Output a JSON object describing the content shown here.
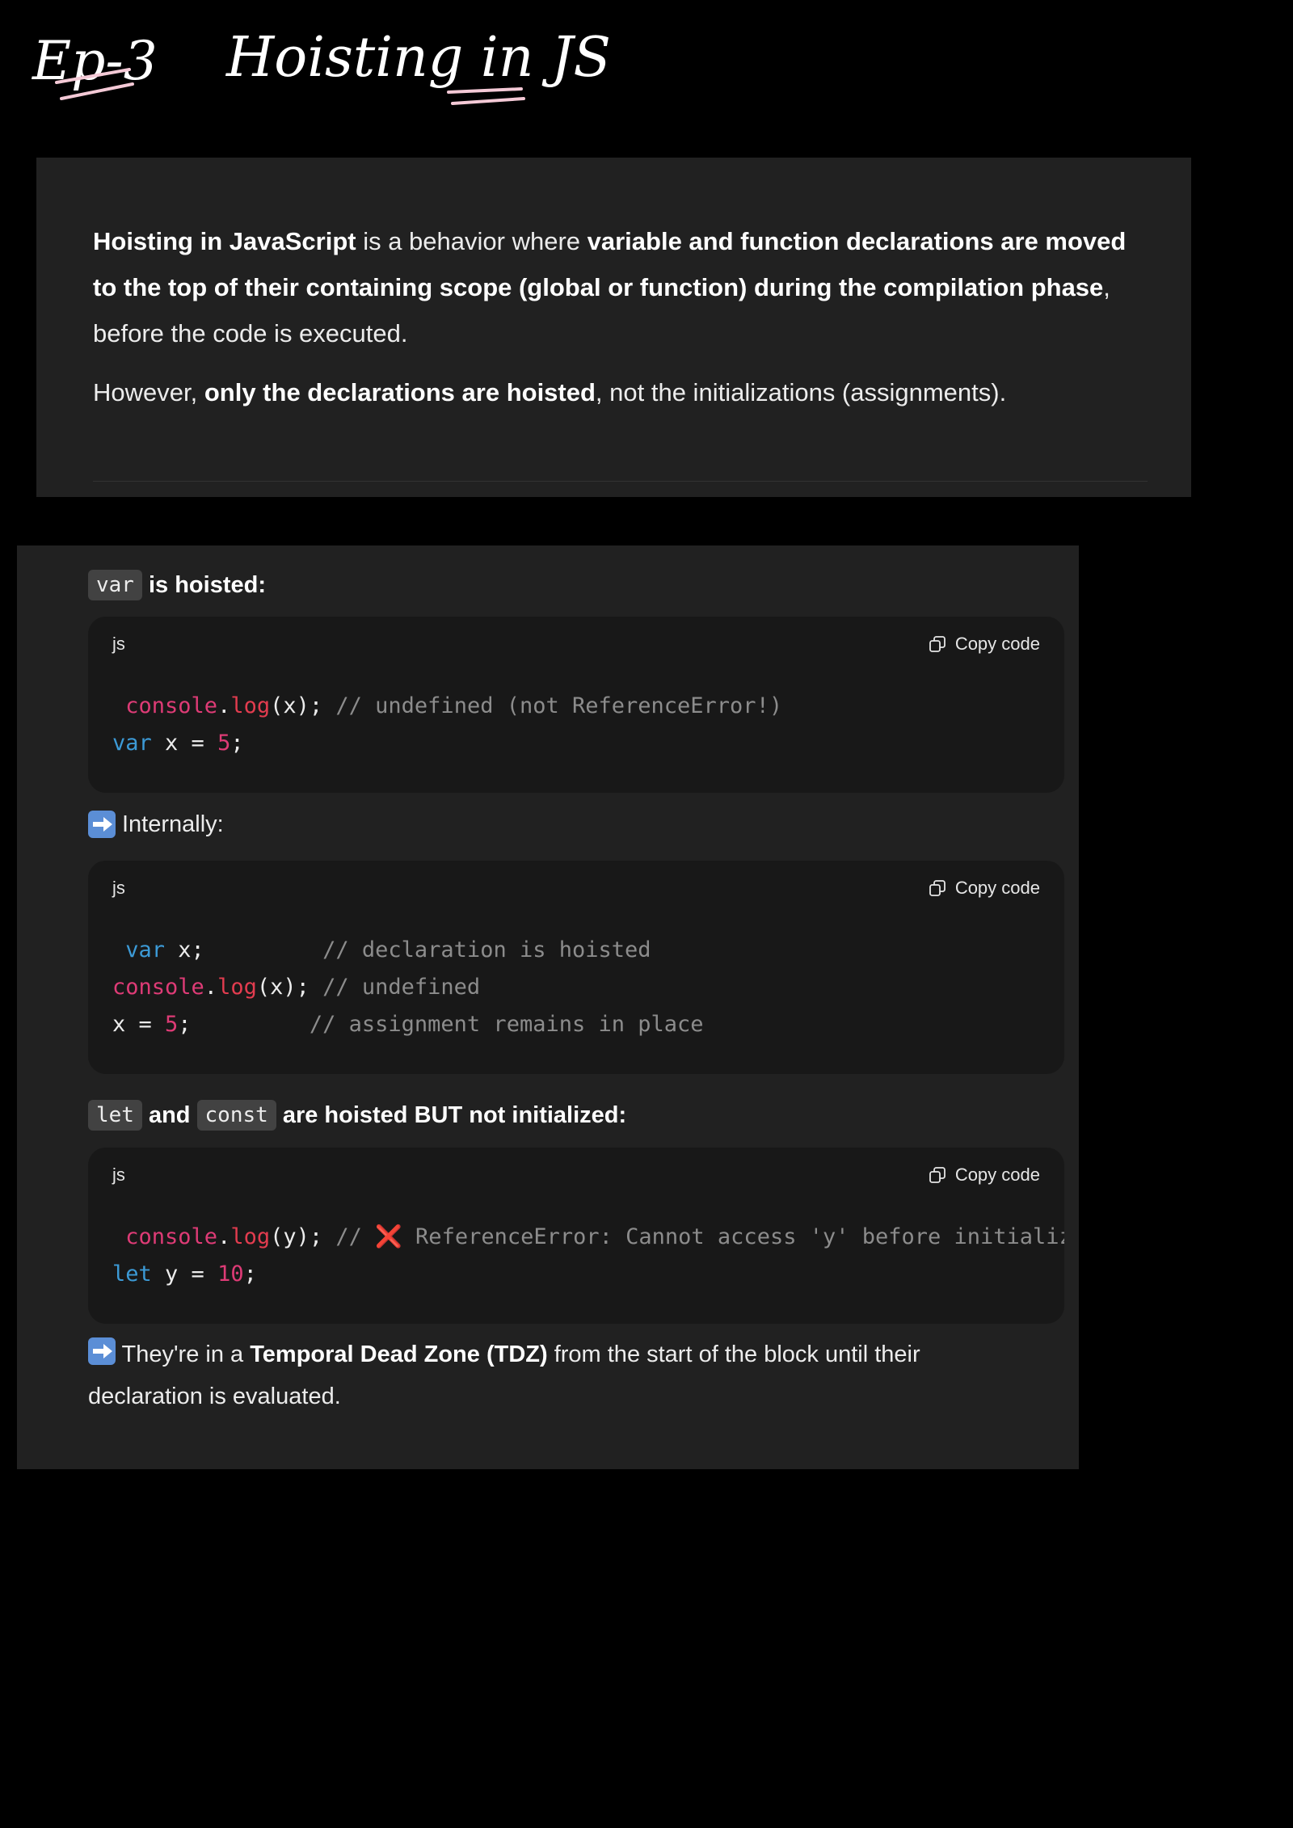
{
  "header": {
    "episode": "Ep-3",
    "title": "Hoisting in JS"
  },
  "intro": {
    "p1_bold1": "Hoisting in JavaScript",
    "p1_text1": " is a behavior where ",
    "p1_bold2": "variable and function declarations are moved to the top of their containing scope (global or function) during the compilation phase",
    "p1_text2": ", before the code is executed.",
    "p2_text1": "However, ",
    "p2_bold": "only the declarations are hoisted",
    "p2_text2": ", not the initializations (assignments)."
  },
  "section_var": {
    "code_label": "var",
    "heading_rest": "is hoisted:"
  },
  "block1": {
    "lang": "js",
    "copy_label": "Copy code",
    "l1_obj": "console",
    "l1_dot": ".",
    "l1_fn": "log",
    "l1_args": "(x); ",
    "l1_comment": "// undefined (not ReferenceError!)",
    "l2_kw": "var",
    "l2_mid": " x = ",
    "l2_num": "5",
    "l2_end": ";"
  },
  "internally": {
    "text": "Internally:"
  },
  "block2": {
    "lang": "js",
    "copy_label": "Copy code",
    "l1_kw": "var",
    "l1_rest": " x;         ",
    "l1_comment": "// declaration is hoisted",
    "l2_obj": "console",
    "l2_dot": ".",
    "l2_fn": "log",
    "l2_args": "(x); ",
    "l2_comment": "// undefined",
    "l3_start": "x = ",
    "l3_num": "5",
    "l3_rest": ";         ",
    "l3_comment": "// assignment remains in place"
  },
  "section_let": {
    "code1": "let",
    "and": "and",
    "code2": "const",
    "heading_rest": "are hoisted BUT not initialized:"
  },
  "block3": {
    "lang": "js",
    "copy_label": "Copy code",
    "l1_obj": "console",
    "l1_dot": ".",
    "l1_fn": "log",
    "l1_args": "(y); ",
    "l1_comment_start": "// ",
    "l1_x": "❌",
    "l1_comment_rest": " ReferenceError: Cannot access 'y' before initializat",
    "l2_kw": "let",
    "l2_mid": " y = ",
    "l2_num": "10",
    "l2_end": ";"
  },
  "tdz": {
    "text1": "They're in a ",
    "bold": "Temporal Dead Zone (TDZ)",
    "text2": " from the start of the block until their declaration is evaluated."
  },
  "colors": {
    "page_bg": "#000000",
    "panel_bg": "#212121",
    "code_bg": "#181818",
    "keyword": "#3c9ad6",
    "function": "#e23c4f",
    "number": "#de3b76",
    "comment": "#8c8c8c",
    "handwriting": "#ffffff",
    "underline": "#f4c9d6"
  }
}
